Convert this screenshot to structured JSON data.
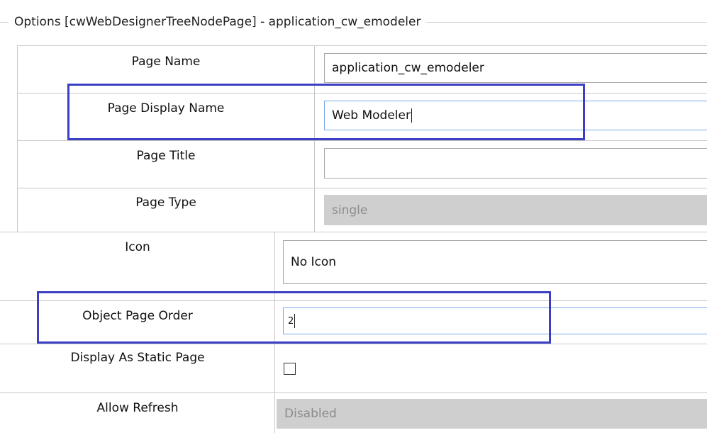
{
  "window": {
    "legend": "Options [cwWebDesignerTreeNodePage] - application_cw_emodeler"
  },
  "fields": {
    "page_name": {
      "label": "Page Name",
      "value": "application_cw_emodeler"
    },
    "page_display_name": {
      "label": "Page Display Name",
      "value": "Web Modeler"
    },
    "page_title": {
      "label": "Page Title",
      "value": ""
    },
    "page_type": {
      "label": "Page Type",
      "value": "single"
    },
    "icon": {
      "label": "Icon",
      "value": "No Icon"
    },
    "object_page_order": {
      "label": "Object Page Order",
      "value": "2"
    },
    "display_as_static_page": {
      "label": "Display As Static Page",
      "checked": false
    },
    "allow_refresh": {
      "label": "Allow Refresh",
      "value": "Disabled"
    }
  },
  "highlight_color": "#3a3fc4",
  "disabled_fill": "#cfcfcf"
}
